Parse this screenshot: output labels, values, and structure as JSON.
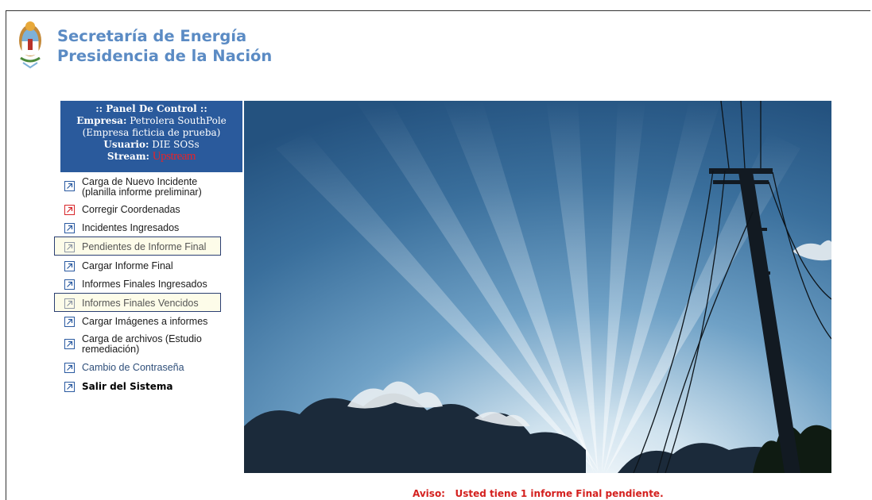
{
  "header": {
    "org_line1": "Secretaría de Energía",
    "org_line2": "Presidencia de la Nación"
  },
  "panel": {
    "title": ":: Panel De Control ::",
    "company_label": "Empresa:",
    "company_value": "Petrolera SouthPole",
    "company_note": "(Empresa ficticia de prueba)",
    "user_label": "Usuario:",
    "user_value": "DIE SOSs",
    "stream_label": "Stream:",
    "stream_value": "Upstream"
  },
  "menu": {
    "items": [
      {
        "line1": "Carga de Nuevo Incidente",
        "line2": "(planilla informe preliminar)",
        "icon": "external-link-icon"
      },
      {
        "line1": "Corregir Coordenadas",
        "icon": "external-link-icon",
        "icon_color": "#d8262a"
      },
      {
        "line1": "Incidentes Ingresados",
        "icon": "external-link-icon"
      },
      {
        "line1": "Pendientes de Informe Final",
        "icon": "external-link-icon",
        "highlighted": true
      },
      {
        "line1": "Cargar Informe Final",
        "icon": "external-link-icon"
      },
      {
        "line1": "Informes Finales Ingresados",
        "icon": "external-link-icon"
      },
      {
        "line1": "Informes Finales Vencidos",
        "icon": "external-link-icon",
        "highlighted": true
      },
      {
        "line1": "Cargar Imágenes a informes",
        "icon": "external-link-icon"
      },
      {
        "line1": "Carga de archivos (Estudio",
        "line2": "remediación)",
        "icon": "external-link-icon"
      },
      {
        "line1": "Cambio de Contraseña",
        "icon": "external-link-icon"
      },
      {
        "line1": "Salir del Sistema",
        "icon": "external-link-icon"
      }
    ]
  },
  "notice": {
    "label": "Aviso:",
    "text": "Usted tiene 1 informe Final pendiente."
  },
  "colors": {
    "brand_blue": "#2a5a9c",
    "alert_red": "#d4201e"
  }
}
